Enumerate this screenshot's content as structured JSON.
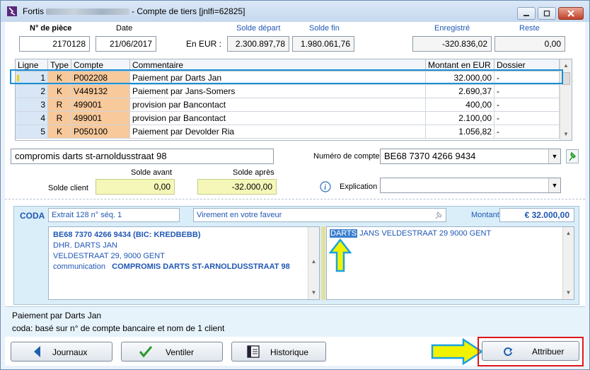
{
  "window": {
    "title_prefix": "Fortis",
    "title_suffix": "- Compte de tiers [jnlfi=62825]"
  },
  "header": {
    "piece_label": "N° de pièce",
    "piece_value": "2170128",
    "date_label": "Date",
    "date_value": "21/06/2017",
    "currency_label": "En EUR :",
    "solde_depart_label": "Solde départ",
    "solde_depart_value": "2.300.897,78",
    "solde_fin_label": "Solde fin",
    "solde_fin_value": "1.980.061,76",
    "enregistre_label": "Enregistré",
    "enregistre_value": "-320.836,02",
    "reste_label": "Reste",
    "reste_value": "0,00"
  },
  "grid": {
    "columns": [
      "Ligne",
      "Type",
      "Compte",
      "Commentaire",
      "Montant en EUR",
      "Dossier"
    ],
    "rows": [
      {
        "ligne": "1",
        "type": "K",
        "compte": "P002208",
        "commentaire": "Paiement par Darts Jan",
        "montant": "32.000,00",
        "dossier": "-"
      },
      {
        "ligne": "2",
        "type": "K",
        "compte": "V449132",
        "commentaire": "Paiement par Jans-Somers",
        "montant": "2.690,37",
        "dossier": "-"
      },
      {
        "ligne": "3",
        "type": "R",
        "compte": "499001",
        "commentaire": "provision par Bancontact",
        "montant": "400,00",
        "dossier": "-"
      },
      {
        "ligne": "4",
        "type": "R",
        "compte": "499001",
        "commentaire": "provision par Bancontact",
        "montant": "2.100,00",
        "dossier": "-"
      },
      {
        "ligne": "5",
        "type": "K",
        "compte": "P050100",
        "commentaire": "Paiement par Devolder Ria",
        "montant": "1.056,82",
        "dossier": "-"
      }
    ]
  },
  "detail": {
    "comment_value": "compromis darts  st-arnoldusstraat 98",
    "numero_compte_label": "Numéro de compte",
    "numero_compte_value": "BE68 7370 4266 9434",
    "solde_avant_label": "Solde avant",
    "solde_apres_label": "Solde après",
    "solde_client_label": "Solde client",
    "solde_avant_value": "0,00",
    "solde_apres_value": "-32.000,00",
    "explication_label": "Explication",
    "explication_value": ""
  },
  "coda": {
    "label": "CODA",
    "extrait": "Extrait 128  n° séq. 1",
    "virement": "Virement en votre faveur",
    "montant_label": "Montant",
    "montant_value": "€ 32.000,00",
    "left_lines": [
      "BE68 7370 4266 9434 (BIC: KREDBEBB)",
      "DHR. DARTS JAN",
      "VELDESTRAAT 29, 9000 GENT"
    ],
    "communication_label": "communication",
    "communication_value": "COMPROMIS DARTS  ST-ARNOLDUSSTRAAT 98",
    "right_highlight": "DARTS",
    "right_rest": " JANS  VELDESTRAAT 29  9000 GENT"
  },
  "status": {
    "line1": "Paiement par Darts Jan",
    "line2": "coda: basé sur n° de compte bancaire et nom de 1 client"
  },
  "buttons": {
    "journaux": "Journaux",
    "ventiler": "Ventiler",
    "historique": "Historique",
    "attribuer": "Attribuer"
  },
  "colors": {
    "accent": "#1a8fd6",
    "annotation_arrow_fill": "#f2f200",
    "annotation_arrow_stroke": "#1aa3e0",
    "annotation_box": "#e0161d",
    "account_cell": "#f8c99b"
  }
}
